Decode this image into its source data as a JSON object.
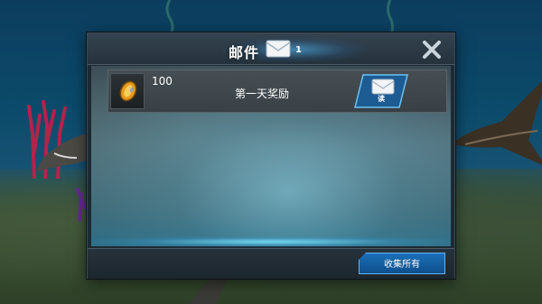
{
  "mail_dialog": {
    "title": "邮件",
    "mail_count": "1",
    "close_icon": "close-x-icon",
    "mails": [
      {
        "reward_icon": "gold-coin-icon",
        "reward_amount": "100",
        "subject": "第一天奖励",
        "read_label": "读"
      }
    ],
    "collect_all_label": "收集所有"
  },
  "colors": {
    "accent": "#1a6fb8",
    "glow": "#50beff",
    "panel": "#1e2a33"
  }
}
